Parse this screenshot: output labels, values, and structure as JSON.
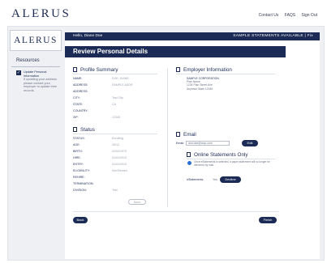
{
  "header": {
    "logo": "ALERUS",
    "links": [
      "Contact Us",
      "FAQS",
      "Sign Out"
    ]
  },
  "sidebar": {
    "logo": "ALERUS",
    "resources_title": "Resources",
    "item": {
      "title": "Update Personal Information",
      "description": "If updating your address please contact your employer to update their records."
    }
  },
  "hello_bar": {
    "greeting": "Hello, Diane Doe",
    "notice": "SAMPLE STATEMENTS AVAILABLE | Fix"
  },
  "page_title": "Review Personal Details",
  "profile": {
    "title": "Profile Summary",
    "rows": [
      {
        "label": "NAME:",
        "value": "DOE, DIANE"
      },
      {
        "label": "ADDRESS:",
        "value": "SAMPLE ADDR"
      },
      {
        "label": "ADDRESS:",
        "value": ""
      },
      {
        "label": "CITY:",
        "value": "Test City"
      },
      {
        "label": "STATE:",
        "value": "CA"
      },
      {
        "label": "COUNTRY:",
        "value": ""
      },
      {
        "label": "ZIP:",
        "value": "12345"
      }
    ]
  },
  "employer": {
    "title": "Employer Information",
    "lines": [
      "SAMPLE CORPORATION",
      "Plan Name",
      "1234 Plan Street Ave",
      "Anytown State 12345"
    ]
  },
  "status": {
    "title": "Status",
    "rows": [
      {
        "label": "STATUS:",
        "value": "Enrolling"
      },
      {
        "label": "AGE:",
        "value": "45/12"
      },
      {
        "label": "BIRTH:",
        "value": "02/02/1970"
      },
      {
        "label": "HIRE:",
        "value": "01/01/2010"
      },
      {
        "label": "ENTRY:",
        "value": "01/01/2010"
      },
      {
        "label": "ELIGIBILITY:",
        "value": "Not Elected"
      },
      {
        "label": "REHIRE:",
        "value": ""
      },
      {
        "label": "TERMINATION:",
        "value": ""
      },
      {
        "label": "DIVISION:",
        "value": "Test"
      }
    ],
    "button": "Done"
  },
  "email": {
    "title": "Email",
    "label": "Email:",
    "value": "dori.doe@corp.com",
    "edit_button": "Edit"
  },
  "online_statements": {
    "title": "Online Statements Only",
    "note": "Once eStatements is selected, a paper statement will no longer be delivered by mail.",
    "label": "eStatements:",
    "current": "Yes",
    "button": "Decline"
  },
  "buttons": {
    "back": "Back",
    "finish": "Finish"
  }
}
